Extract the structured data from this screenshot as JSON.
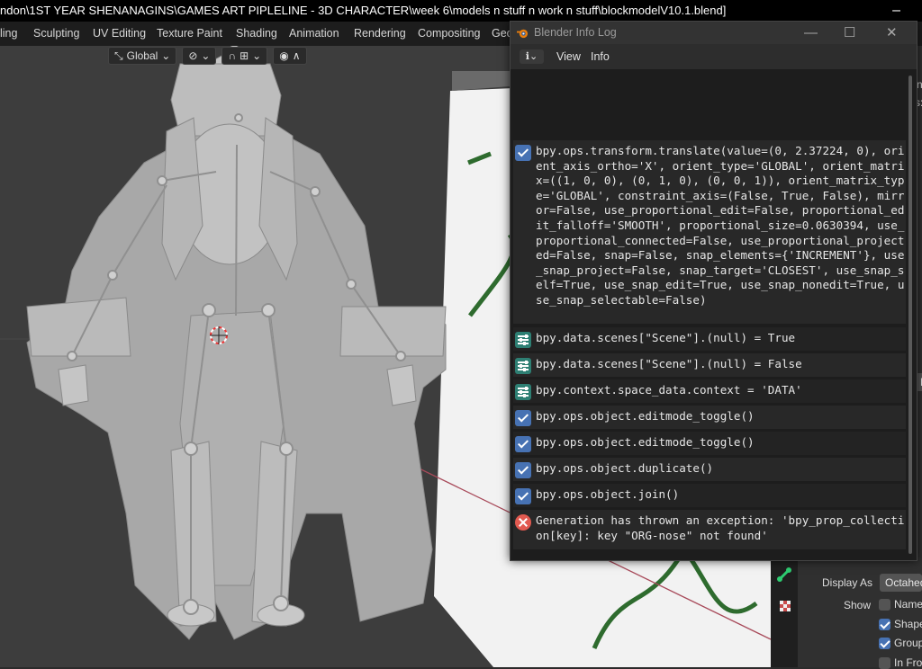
{
  "window": {
    "title": "ndon\\1ST YEAR SHENANAGINS\\GAMES ART PIPLELINE - 3D CHARACTER\\week 6\\models n stuff n work n stuff\\blockmodelV10.1.blend]",
    "minimize_glyph": "–"
  },
  "workspace_tabs": [
    "ling",
    "Sculpting",
    "UV Editing",
    "Texture Paint",
    "Shading",
    "Animation",
    "Rendering",
    "Compositing",
    "Geo"
  ],
  "viewport": {
    "orientation_label": "Global",
    "chevron": "⌄"
  },
  "info_log": {
    "title": "Blender Info Log",
    "menu": {
      "editor_type": "ℹ⌄",
      "view": "View",
      "info": "Info"
    },
    "controls": {
      "minimize": "—",
      "maximize": "☐",
      "close": "✕"
    },
    "entries": [
      {
        "type": "operator",
        "text": "bpy.ops.transform.translate(value=(0, 2.37224, 0), orient_axis_ortho='X', orient_type='GLOBAL', orient_matrix=((1, 0, 0), (0, 1, 0), (0, 0, 1)), orient_matrix_type='GLOBAL', constraint_axis=(False, True, False), mirror=False, use_proportional_edit=False, proportional_edit_falloff='SMOOTH', proportional_size=0.0630394, use_proportional_connected=False, use_proportional_projected=False, snap=False, snap_elements={'INCREMENT'}, use_snap_project=False, snap_target='CLOSEST', use_snap_self=True, use_snap_edit=True, use_snap_nonedit=True, use_snap_selectable=False)"
      },
      {
        "type": "property",
        "text": "bpy.data.scenes[\"Scene\"].(null) = True"
      },
      {
        "type": "property",
        "text": "bpy.data.scenes[\"Scene\"].(null) = False"
      },
      {
        "type": "property",
        "text": "bpy.context.space_data.context = 'DATA'"
      },
      {
        "type": "operator",
        "text": "bpy.ops.object.editmode_toggle()"
      },
      {
        "type": "operator",
        "text": "bpy.ops.object.editmode_toggle()"
      },
      {
        "type": "operator",
        "text": "bpy.ops.object.duplicate()"
      },
      {
        "type": "operator",
        "text": "bpy.ops.object.join()"
      },
      {
        "type": "error",
        "text": "Generation has thrown an exception: 'bpy_prop_collection[key]: key \"ORG-nose\" not found'"
      }
    ]
  },
  "properties_panel": {
    "top_snippets": [
      "ne",
      "s:1",
      "Re"
    ],
    "display_as_label": "Display As",
    "display_as_value": "Octahedral",
    "show_label": "Show",
    "show_options": [
      {
        "label": "Names",
        "checked": false
      },
      {
        "label": "Shapes",
        "checked": true
      },
      {
        "label": "Group Colors",
        "checked": true
      },
      {
        "label": "In Front",
        "checked": false
      }
    ]
  },
  "colors": {
    "accent": "#4772b3",
    "property_icon": "#2e7f73",
    "error_icon": "#e25a50",
    "bone_green": "#2ecc71"
  }
}
